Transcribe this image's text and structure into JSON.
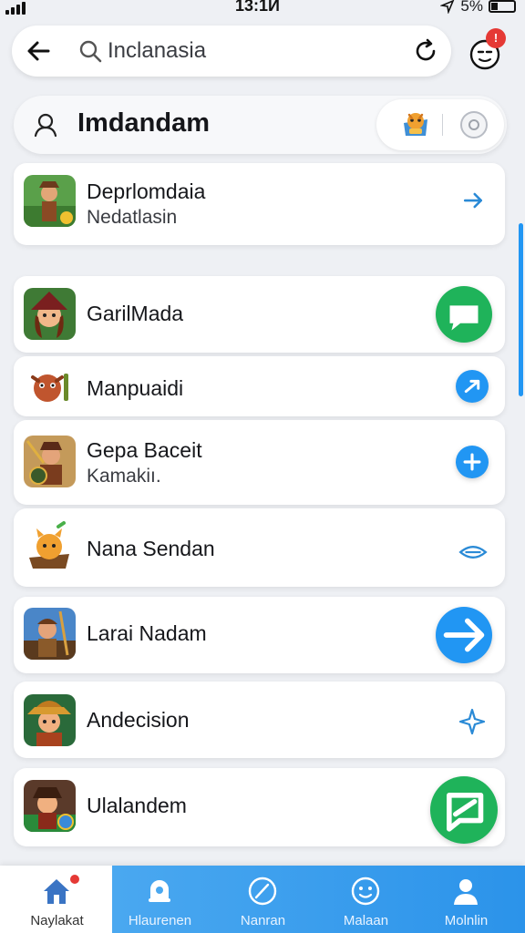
{
  "status_bar": {
    "time": "13:1Й",
    "battery": "5%"
  },
  "search": {
    "query": "Inclanasia"
  },
  "profile": {
    "badge": "!"
  },
  "user": {
    "name": "Imdandam"
  },
  "games": [
    {
      "title": "Deprlomdaia",
      "subtitle": "Nedatlasin",
      "icon": "adventurer-game-icon",
      "action": "arrow-right-icon"
    },
    {
      "title": "GarilMada",
      "subtitle": "",
      "icon": "witch-game-icon",
      "action": "chat-bubble-icon"
    },
    {
      "title": "Manpuaidi",
      "subtitle": "",
      "icon": "creature-game-icon",
      "action": "arrow-circle-icon"
    },
    {
      "title": "Gepa Baceit",
      "subtitle": "Kamakiı.",
      "icon": "warrior-game-icon",
      "action": "plus-icon"
    },
    {
      "title": "Nana Sendan",
      "subtitle": "",
      "icon": "cat-game-icon",
      "action": "eye-icon"
    },
    {
      "title": "Larai Nadam",
      "subtitle": "",
      "icon": "hunter-game-icon",
      "action": "arrow-right-icon"
    },
    {
      "title": "Andecision",
      "subtitle": "",
      "icon": "ranger-game-icon",
      "action": "sparkle-icon"
    },
    {
      "title": "Ulalandem",
      "subtitle": "",
      "icon": "pirate-game-icon",
      "action": "send-icon"
    }
  ],
  "nav": [
    {
      "label": "Naylakat",
      "icon": "home-icon"
    },
    {
      "label": "Hlaurenen",
      "icon": "bell-icon"
    },
    {
      "label": "Nanran",
      "icon": "compass-icon"
    },
    {
      "label": "Malaan",
      "icon": "smile-icon"
    },
    {
      "label": "Molnlin",
      "icon": "person-icon"
    }
  ],
  "colors": {
    "accent": "#2196f3",
    "green": "#1fb35a",
    "badge": "#e53935"
  }
}
